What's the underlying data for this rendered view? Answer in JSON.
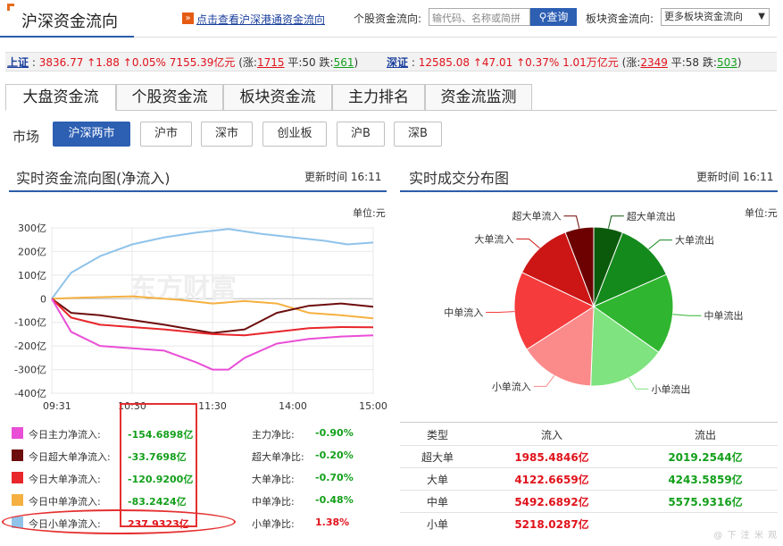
{
  "header": {
    "title": "沪深资金流向",
    "hk_icon": "»",
    "hk_link": "点击查看沪深港通资金流向",
    "stock_label": "个股资金流向:",
    "stock_placeholder": "输代码、名称或简拼",
    "query_label": "查询",
    "sector_label": "板块资金流向:",
    "sector_value": "更多板块资金流向"
  },
  "indices": {
    "sh": {
      "name": "上证",
      "value": "3836.77",
      "change": "↑1.88",
      "pct": "↑0.05%",
      "amount": "7155.39亿元",
      "up_label": "(涨:",
      "up": "1715",
      "flat_label": "平:",
      "flat": "50",
      "down_label": "跌:",
      "down": "561",
      "close": ")"
    },
    "sz": {
      "name": "深证",
      "value": "12585.08",
      "change": "↑47.01",
      "pct": "↑0.37%",
      "amount": "1.01万亿元",
      "up_label": "(涨:",
      "up": "2349",
      "flat_label": "平:",
      "flat": "58",
      "down_label": "跌:",
      "down": "503",
      "close": ")"
    }
  },
  "tabs": [
    "大盘资金流",
    "个股资金流",
    "板块资金流",
    "主力排名",
    "资金流监测"
  ],
  "market": {
    "label": "市场",
    "buttons": [
      "沪深两市",
      "沪市",
      "深市",
      "创业板",
      "沪B",
      "深B"
    ]
  },
  "flow_chart": {
    "title": "实时资金流向图(净流入)",
    "update_label": "更新时间",
    "update_time": "16:11",
    "unit": "单位:元",
    "watermark": "东方财富"
  },
  "pie_chart": {
    "title": "实时成交分布图",
    "update_label": "更新时间",
    "update_time": "16:11",
    "unit": "单位:元"
  },
  "legend": [
    {
      "label": "今日主力净流入:",
      "value": "-154.6898亿",
      "ratio_label": "主力净比:",
      "ratio": "-0.90%",
      "color": "#e94ed6",
      "sign": "neg"
    },
    {
      "label": "今日超大单净流入:",
      "value": "-33.7698亿",
      "ratio_label": "超大单净比:",
      "ratio": "-0.20%",
      "color": "#6d0d0d",
      "sign": "neg"
    },
    {
      "label": "今日大单净流入:",
      "value": "-120.9200亿",
      "ratio_label": "大单净比:",
      "ratio": "-0.70%",
      "color": "#e8262b",
      "sign": "neg"
    },
    {
      "label": "今日中单净流入:",
      "value": "-83.2424亿",
      "ratio_label": "中单净比:",
      "ratio": "-0.48%",
      "color": "#f5b041",
      "sign": "neg"
    },
    {
      "label": "今日小单净流入:",
      "value": "237.9323亿",
      "ratio_label": "小单净比:",
      "ratio": "1.38%",
      "color": "#8fc3ea",
      "sign": "pos"
    }
  ],
  "table": {
    "headers": [
      "类型",
      "流入",
      "流出"
    ],
    "rows": [
      {
        "type": "超大单",
        "in": "1985.4846亿",
        "out": "2019.2544亿"
      },
      {
        "type": "大单",
        "in": "4122.6659亿",
        "out": "4243.5859亿"
      },
      {
        "type": "中单",
        "in": "5492.6892亿",
        "out": "5575.9316亿"
      },
      {
        "type": "小单",
        "in": "5218.0287亿",
        "out": ""
      }
    ]
  },
  "bottom_watermark": "@ 下 注 米 观",
  "chart_data": [
    {
      "type": "line",
      "ylim": [
        -400,
        300
      ],
      "ytick_labels": [
        "300亿",
        "200亿",
        "100亿",
        "0",
        "-100亿",
        "-200亿",
        "-300亿",
        "-400亿"
      ],
      "yticks": [
        300,
        200,
        100,
        0,
        -100,
        -200,
        -300,
        -400
      ],
      "xtick_labels": [
        "09:31",
        "10:30",
        "11:30",
        "14:00",
        "15:00"
      ],
      "xticks": [
        0,
        0.25,
        0.5,
        0.75,
        1.0
      ],
      "grid": true,
      "series": [
        {
          "color": "#8fc3ea",
          "x": [
            0,
            0.06,
            0.15,
            0.25,
            0.35,
            0.45,
            0.55,
            0.65,
            0.75,
            0.85,
            0.92,
            1.0
          ],
          "values": [
            0,
            110,
            180,
            230,
            260,
            280,
            295,
            275,
            260,
            245,
            230,
            238
          ]
        },
        {
          "color": "#f5b041",
          "x": [
            0,
            0.1,
            0.25,
            0.4,
            0.5,
            0.6,
            0.7,
            0.8,
            0.9,
            1.0
          ],
          "values": [
            0,
            5,
            10,
            -5,
            -20,
            -10,
            -20,
            -60,
            -70,
            -83
          ]
        },
        {
          "color": "#6d0d0d",
          "x": [
            0,
            0.06,
            0.15,
            0.25,
            0.35,
            0.5,
            0.6,
            0.7,
            0.8,
            0.9,
            1.0
          ],
          "values": [
            0,
            -60,
            -70,
            -90,
            -110,
            -145,
            -130,
            -60,
            -30,
            -20,
            -34
          ]
        },
        {
          "color": "#e8262b",
          "x": [
            0,
            0.06,
            0.15,
            0.25,
            0.35,
            0.5,
            0.6,
            0.7,
            0.8,
            0.9,
            1.0
          ],
          "values": [
            0,
            -80,
            -110,
            -120,
            -130,
            -150,
            -155,
            -140,
            -125,
            -120,
            -121
          ]
        },
        {
          "color": "#e94ed6",
          "x": [
            0,
            0.06,
            0.15,
            0.25,
            0.35,
            0.45,
            0.5,
            0.55,
            0.6,
            0.7,
            0.8,
            0.9,
            1.0
          ],
          "values": [
            0,
            -140,
            -200,
            -210,
            -220,
            -270,
            -300,
            -300,
            -250,
            -190,
            -170,
            -160,
            -155
          ]
        }
      ]
    },
    {
      "type": "pie",
      "slices": [
        {
          "label": "超大单流出",
          "value": 2019.2544,
          "color": "#0b5a0b"
        },
        {
          "label": "大单流出",
          "value": 4243.5859,
          "color": "#14891c"
        },
        {
          "label": "中单流出",
          "value": 5575.9316,
          "color": "#2fb52f"
        },
        {
          "label": "小单流出",
          "value": 5400,
          "color": "#7fe37f"
        },
        {
          "label": "小单流入",
          "value": 5218.0287,
          "color": "#fb8a8a"
        },
        {
          "label": "中单流入",
          "value": 5492.6892,
          "color": "#f53b3b"
        },
        {
          "label": "大单流入",
          "value": 4122.6659,
          "color": "#cc1515"
        },
        {
          "label": "超大单流入",
          "value": 1985.4846,
          "color": "#6d0000"
        }
      ]
    }
  ]
}
